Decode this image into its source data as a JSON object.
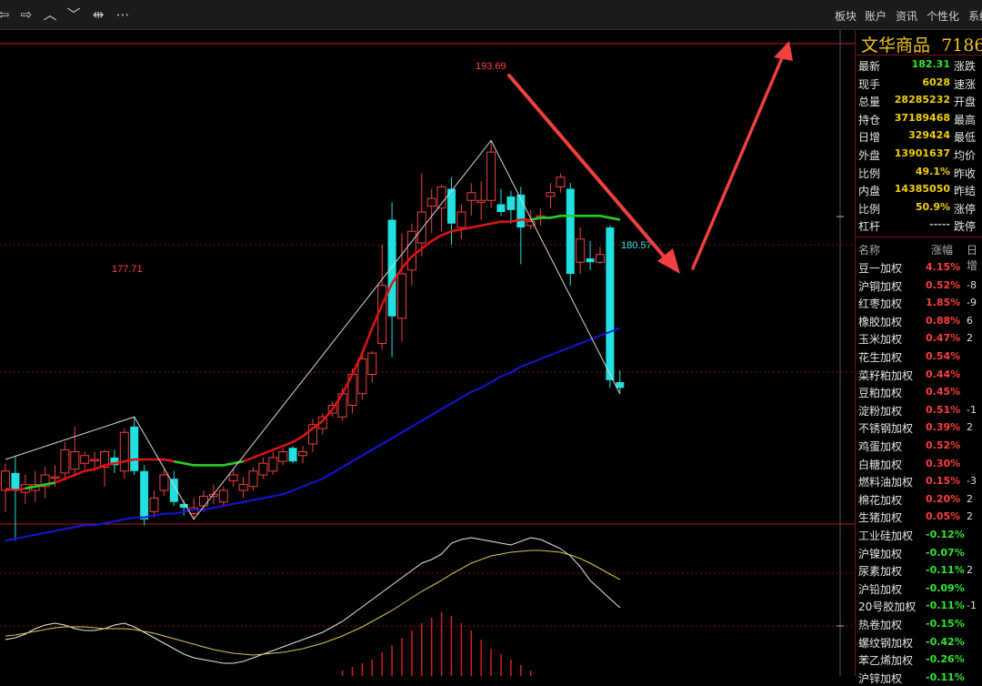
{
  "toolbar": {
    "icons": [
      "arrow-left-icon",
      "arrow-right-icon",
      "chevron-up-icon",
      "chevron-down-icon",
      "split-icon",
      "more-icon"
    ],
    "icon_glyphs": [
      "⇦",
      "⇨",
      "︿",
      "﹀",
      "⇹",
      "⋯"
    ],
    "menu": [
      "板块",
      "账户",
      "资讯",
      "个性化",
      "系统"
    ]
  },
  "quote": {
    "title": "文华商品",
    "code": "7186",
    "rows": [
      {
        "label": "最新",
        "value": "182.31",
        "right": "涨跌",
        "color": "#2ee82e"
      },
      {
        "label": "现手",
        "value": "6028",
        "right": "速涨",
        "color": "#f0d000"
      },
      {
        "label": "总量",
        "value": "28285232",
        "right": "开盘",
        "color": "#f0d000"
      },
      {
        "label": "持仓",
        "value": "37189468",
        "right": "最高",
        "color": "#f0d000"
      },
      {
        "label": "日增",
        "value": "329424",
        "right": "最低",
        "color": "#f0d000"
      },
      {
        "label": "外盘",
        "value": "13901637",
        "right": "均价",
        "color": "#f0d000"
      },
      {
        "label": "比例",
        "value": "49.1%",
        "right": "昨收",
        "color": "#f0d000"
      },
      {
        "label": "内盘",
        "value": "14385050",
        "right": "昨结",
        "color": "#f0d000"
      },
      {
        "label": "比例",
        "value": "50.9%",
        "right": "涨停",
        "color": "#f0d000"
      },
      {
        "label": "杠杆",
        "value": "-----",
        "right": "跌停",
        "color": "#bbbbbb"
      }
    ]
  },
  "list": {
    "headers": [
      "名称",
      "涨幅",
      "日增"
    ],
    "rows": [
      {
        "name": "豆一加权",
        "pct": "4.15%",
        "extra": "",
        "color": "#ff3c3c"
      },
      {
        "name": "沪铜加权",
        "pct": "0.52%",
        "extra": "-8",
        "color": "#ff3c3c"
      },
      {
        "name": "红枣加权",
        "pct": "1.85%",
        "extra": "-9",
        "color": "#ff3c3c"
      },
      {
        "name": "橡胶加权",
        "pct": "0.88%",
        "extra": "6",
        "color": "#ff3c3c"
      },
      {
        "name": "玉米加权",
        "pct": "0.47%",
        "extra": "2",
        "color": "#ff3c3c"
      },
      {
        "name": "花生加权",
        "pct": "0.54%",
        "extra": "",
        "color": "#ff3c3c"
      },
      {
        "name": "菜籽粕加权",
        "pct": "0.44%",
        "extra": "",
        "color": "#ff3c3c"
      },
      {
        "name": "豆粕加权",
        "pct": "0.45%",
        "extra": "",
        "color": "#ff3c3c"
      },
      {
        "name": "淀粉加权",
        "pct": "0.51%",
        "extra": "-1",
        "color": "#ff3c3c"
      },
      {
        "name": "不锈钢加权",
        "pct": "0.39%",
        "extra": "2",
        "color": "#ff3c3c"
      },
      {
        "name": "鸡蛋加权",
        "pct": "0.52%",
        "extra": "",
        "color": "#ff3c3c"
      },
      {
        "name": "白糖加权",
        "pct": "0.30%",
        "extra": "",
        "color": "#ff3c3c"
      },
      {
        "name": "燃料油加权",
        "pct": "0.15%",
        "extra": "-3",
        "color": "#ff3c3c"
      },
      {
        "name": "棉花加权",
        "pct": "0.20%",
        "extra": "2",
        "color": "#ff3c3c"
      },
      {
        "name": "生猪加权",
        "pct": "0.05%",
        "extra": "2",
        "color": "#ff3c3c"
      },
      {
        "name": "工业硅加权",
        "pct": "-0.12%",
        "extra": "",
        "color": "#2ee82e"
      },
      {
        "name": "沪镍加权",
        "pct": "-0.07%",
        "extra": "",
        "color": "#2ee82e"
      },
      {
        "name": "尿素加权",
        "pct": "-0.11%",
        "extra": "2",
        "color": "#2ee82e"
      },
      {
        "name": "沪铅加权",
        "pct": "-0.09%",
        "extra": "",
        "color": "#2ee82e"
      },
      {
        "name": "20号胶加权",
        "pct": "-0.11%",
        "extra": "-1",
        "color": "#2ee82e"
      },
      {
        "name": "热卷加权",
        "pct": "-0.15%",
        "extra": "",
        "color": "#2ee82e"
      },
      {
        "name": "螺纹钢加权",
        "pct": "-0.42%",
        "extra": "",
        "color": "#2ee82e"
      },
      {
        "name": "苯乙烯加权",
        "pct": "-0.26%",
        "extra": "",
        "color": "#2ee82e"
      },
      {
        "name": "沪锌加权",
        "pct": "-0.11%",
        "extra": "",
        "color": "#2ee82e"
      }
    ]
  },
  "chart_data": {
    "type": "candlestick",
    "annotations": [
      "193.69",
      "177.71",
      "180.57"
    ],
    "price_axis_ylim": [
      174,
      198
    ],
    "candles": [
      {
        "o": 175.6,
        "h": 177.0,
        "l": 174.5,
        "c": 176.6
      },
      {
        "o": 176.5,
        "h": 177.4,
        "l": 173.0,
        "c": 175.6
      },
      {
        "o": 175.5,
        "h": 176.4,
        "l": 174.9,
        "c": 175.9
      },
      {
        "o": 175.6,
        "h": 176.6,
        "l": 175.0,
        "c": 175.9
      },
      {
        "o": 175.8,
        "h": 176.8,
        "l": 175.2,
        "c": 176.4
      },
      {
        "o": 176.3,
        "h": 176.9,
        "l": 175.8,
        "c": 176.3
      },
      {
        "o": 176.5,
        "h": 178.1,
        "l": 176.1,
        "c": 177.7
      },
      {
        "o": 176.7,
        "h": 178.9,
        "l": 176.3,
        "c": 177.6
      },
      {
        "o": 177.0,
        "h": 177.6,
        "l": 176.7,
        "c": 177.4
      },
      {
        "o": 177.2,
        "h": 177.6,
        "l": 176.6,
        "c": 177.2
      },
      {
        "o": 176.8,
        "h": 177.7,
        "l": 175.8,
        "c": 177.6
      },
      {
        "o": 177.3,
        "h": 177.7,
        "l": 176.5,
        "c": 176.9
      },
      {
        "o": 176.6,
        "h": 178.8,
        "l": 176.2,
        "c": 178.6
      },
      {
        "o": 178.9,
        "h": 179.4,
        "l": 176.4,
        "c": 176.6
      },
      {
        "o": 176.6,
        "h": 176.9,
        "l": 173.8,
        "c": 174.1
      },
      {
        "o": 174.5,
        "h": 175.6,
        "l": 174.2,
        "c": 175.2
      },
      {
        "o": 175.6,
        "h": 176.8,
        "l": 175.3,
        "c": 176.4
      },
      {
        "o": 176.2,
        "h": 176.6,
        "l": 174.8,
        "c": 175.0
      },
      {
        "o": 174.9,
        "h": 175.1,
        "l": 174.3,
        "c": 174.7
      },
      {
        "o": 174.4,
        "h": 175.2,
        "l": 174.1,
        "c": 174.7
      },
      {
        "o": 174.8,
        "h": 175.6,
        "l": 174.5,
        "c": 175.3
      },
      {
        "o": 175.3,
        "h": 175.9,
        "l": 174.9,
        "c": 175.4
      },
      {
        "o": 175.0,
        "h": 175.8,
        "l": 174.8,
        "c": 175.6
      },
      {
        "o": 176.1,
        "h": 176.7,
        "l": 175.8,
        "c": 176.4
      },
      {
        "o": 175.6,
        "h": 176.3,
        "l": 175.2,
        "c": 175.9
      },
      {
        "o": 175.8,
        "h": 176.8,
        "l": 175.6,
        "c": 176.6
      },
      {
        "o": 176.4,
        "h": 177.3,
        "l": 176.2,
        "c": 177.0
      },
      {
        "o": 176.6,
        "h": 177.6,
        "l": 176.4,
        "c": 177.3
      },
      {
        "o": 177.1,
        "h": 177.8,
        "l": 176.9,
        "c": 177.6
      },
      {
        "o": 177.8,
        "h": 177.9,
        "l": 177.0,
        "c": 177.1
      },
      {
        "o": 177.4,
        "h": 177.9,
        "l": 177.0,
        "c": 177.6
      },
      {
        "o": 178.0,
        "h": 179.3,
        "l": 177.6,
        "c": 179.0
      },
      {
        "o": 178.8,
        "h": 179.6,
        "l": 178.5,
        "c": 179.4
      },
      {
        "o": 179.6,
        "h": 180.2,
        "l": 179.4,
        "c": 180.0
      },
      {
        "o": 179.4,
        "h": 180.9,
        "l": 179.2,
        "c": 180.6
      },
      {
        "o": 180.0,
        "h": 181.9,
        "l": 179.6,
        "c": 181.6
      },
      {
        "o": 180.6,
        "h": 182.7,
        "l": 180.3,
        "c": 182.4
      },
      {
        "o": 181.6,
        "h": 182.8,
        "l": 181.2,
        "c": 182.7
      },
      {
        "o": 183.2,
        "h": 188.3,
        "l": 182.9,
        "c": 186.2
      },
      {
        "o": 189.6,
        "h": 190.5,
        "l": 182.5,
        "c": 184.6
      },
      {
        "o": 184.5,
        "h": 188.9,
        "l": 183.3,
        "c": 186.8
      },
      {
        "o": 187.0,
        "h": 189.4,
        "l": 186.2,
        "c": 189.0
      },
      {
        "o": 188.4,
        "h": 192.0,
        "l": 187.7,
        "c": 190.0
      },
      {
        "o": 190.3,
        "h": 191.2,
        "l": 188.9,
        "c": 190.7
      },
      {
        "o": 190.2,
        "h": 191.4,
        "l": 189.0,
        "c": 191.3
      },
      {
        "o": 191.2,
        "h": 191.8,
        "l": 188.3,
        "c": 189.4
      },
      {
        "o": 189.2,
        "h": 190.4,
        "l": 188.6,
        "c": 190.0
      },
      {
        "o": 190.6,
        "h": 191.5,
        "l": 189.8,
        "c": 191.0
      },
      {
        "o": 190.5,
        "h": 191.6,
        "l": 189.6,
        "c": 190.6
      },
      {
        "o": 190.6,
        "h": 193.7,
        "l": 190.2,
        "c": 193.1
      },
      {
        "o": 190.4,
        "h": 191.2,
        "l": 189.8,
        "c": 190.0
      },
      {
        "o": 190.8,
        "h": 191.1,
        "l": 189.4,
        "c": 190.1
      },
      {
        "o": 190.9,
        "h": 191.3,
        "l": 187.3,
        "c": 189.2
      },
      {
        "o": 189.3,
        "h": 190.1,
        "l": 189.1,
        "c": 189.5
      },
      {
        "o": 189.8,
        "h": 190.2,
        "l": 189.3,
        "c": 189.8
      },
      {
        "o": 190.8,
        "h": 191.5,
        "l": 190.2,
        "c": 191.0
      },
      {
        "o": 191.3,
        "h": 192.0,
        "l": 191.0,
        "c": 191.8
      },
      {
        "o": 191.2,
        "h": 191.5,
        "l": 186.2,
        "c": 186.8
      },
      {
        "o": 187.4,
        "h": 189.2,
        "l": 186.8,
        "c": 188.6
      },
      {
        "o": 187.6,
        "h": 188.5,
        "l": 187.0,
        "c": 187.4
      },
      {
        "o": 187.4,
        "h": 188.2,
        "l": 187.3,
        "c": 187.8
      },
      {
        "o": 189.2,
        "h": 189.3,
        "l": 180.9,
        "c": 181.3
      },
      {
        "o": 181.2,
        "h": 181.8,
        "l": 180.6,
        "c": 180.9
      }
    ],
    "ma_short": [
      175.7,
      175.6,
      175.7,
      175.8,
      175.9,
      176.0,
      176.2,
      176.4,
      176.6,
      176.7,
      176.9,
      177.0,
      177.1,
      177.2,
      177.2,
      177.2,
      177.2,
      177.1,
      177.0,
      176.9,
      176.9,
      176.9,
      176.9,
      177.0,
      177.1,
      177.3,
      177.5,
      177.7,
      177.9,
      178.1,
      178.4,
      178.8,
      179.2,
      179.8,
      180.6,
      181.6,
      182.7,
      184.0,
      185.2,
      186.3,
      187.1,
      187.7,
      188.1,
      188.5,
      188.8,
      189.0,
      189.1,
      189.2,
      189.3,
      189.4,
      189.5,
      189.5,
      189.6,
      189.6,
      189.7,
      189.7,
      189.8,
      189.8,
      189.8,
      189.8,
      189.8,
      189.7,
      189.6
    ],
    "ma_long": [
      173.0,
      173.1,
      173.2,
      173.3,
      173.4,
      173.5,
      173.6,
      173.7,
      173.8,
      173.8,
      173.9,
      174.0,
      174.1,
      174.2,
      174.2,
      174.3,
      174.4,
      174.4,
      174.5,
      174.6,
      174.6,
      174.7,
      174.8,
      174.9,
      175.0,
      175.1,
      175.2,
      175.3,
      175.4,
      175.6,
      175.8,
      176.0,
      176.2,
      176.5,
      176.8,
      177.1,
      177.4,
      177.7,
      178.0,
      178.3,
      178.6,
      178.9,
      179.2,
      179.5,
      179.8,
      180.1,
      180.4,
      180.7,
      180.9,
      181.2,
      181.5,
      181.7,
      182.0,
      182.2,
      182.4,
      182.6,
      182.8,
      183.0,
      183.2,
      183.4,
      183.6,
      183.8,
      184.0
    ],
    "indicator_bars": [
      0,
      0,
      0,
      0,
      0,
      0,
      0,
      0,
      0,
      0,
      0,
      0,
      0,
      0,
      0,
      0,
      0,
      0,
      0,
      0,
      0,
      0,
      0,
      0,
      0,
      0,
      0,
      0,
      0,
      0,
      0,
      0,
      0,
      0,
      6,
      10,
      14,
      18,
      26,
      34,
      42,
      50,
      58,
      64,
      70,
      66,
      58,
      50,
      40,
      30,
      24,
      18,
      12,
      6,
      0,
      0,
      0,
      0,
      0,
      0,
      0,
      0,
      0
    ],
    "indicator_dif": [
      40,
      42,
      46,
      52,
      56,
      58,
      56,
      52,
      50,
      50,
      52,
      56,
      58,
      54,
      48,
      42,
      36,
      30,
      24,
      20,
      18,
      16,
      14,
      14,
      16,
      20,
      24,
      28,
      32,
      36,
      40,
      44,
      48,
      54,
      60,
      68,
      76,
      84,
      92,
      100,
      108,
      116,
      124,
      128,
      134,
      146,
      150,
      152,
      150,
      148,
      146,
      144,
      148,
      152,
      150,
      145,
      140,
      132,
      120,
      105,
      95,
      85,
      75
    ],
    "indicator_dea": [
      44,
      45,
      47,
      49,
      51,
      53,
      54,
      54,
      54,
      53,
      52,
      52,
      52,
      51,
      49,
      47,
      44,
      41,
      38,
      35,
      32,
      29,
      27,
      25,
      24,
      23,
      24,
      25,
      26,
      28,
      30,
      33,
      36,
      40,
      44,
      49,
      54,
      60,
      66,
      72,
      79,
      86,
      93,
      99,
      105,
      112,
      118,
      124,
      128,
      132,
      134,
      136,
      137,
      138,
      138,
      137,
      136,
      133,
      129,
      124,
      118,
      112,
      106
    ]
  }
}
